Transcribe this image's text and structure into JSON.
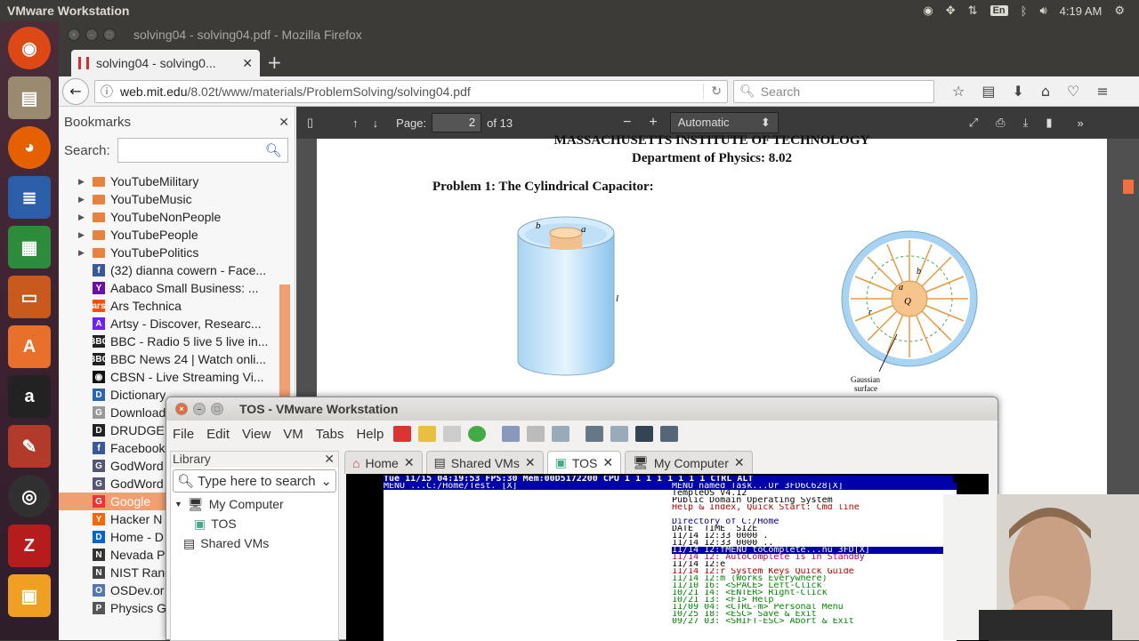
{
  "topbar": {
    "app": "VMware Workstation",
    "lang": "En",
    "time": "4:19 AM"
  },
  "launcher": {
    "items": [
      "ubuntu-icon",
      "files-icon",
      "firefox-icon",
      "writer-icon",
      "calc-icon",
      "impress-icon",
      "software-center-icon",
      "amazon-icon",
      "settings-icon",
      "obs-icon",
      "filezilla-icon",
      "vmware-icon"
    ]
  },
  "firefox": {
    "window_title": "solving04 - solving04.pdf - Mozilla Firefox",
    "tab_title": "solving04 - solving0...",
    "url_host": "web.mit.edu",
    "url_path": "/8.02t/www/materials/ProblemSolving/solving04.pdf",
    "search_placeholder": "Search"
  },
  "sidebar": {
    "title": "Bookmarks",
    "search_label": "Search:",
    "items": [
      {
        "label": "YouTubeMilitary",
        "type": "folder"
      },
      {
        "label": "YouTubeMusic",
        "type": "folder"
      },
      {
        "label": "YouTubeNonPeople",
        "type": "folder"
      },
      {
        "label": "YouTubePeople",
        "type": "folder"
      },
      {
        "label": "YouTubePolitics",
        "type": "folder"
      },
      {
        "label": "(32) dianna cowern - Face...",
        "fav": "f",
        "color": "#3b5998"
      },
      {
        "label": "Aabaco Small Business: ...",
        "fav": "Y",
        "color": "#6b0fa8"
      },
      {
        "label": "Ars Technica",
        "fav": "ars",
        "color": "#ff4e00"
      },
      {
        "label": "Artsy - Discover, Researc...",
        "fav": "A",
        "color": "#6e1fff"
      },
      {
        "label": "BBC - Radio 5 live 5 live in...",
        "fav": "BBC",
        "color": "#222"
      },
      {
        "label": "BBC News 24 | Watch onli...",
        "fav": "BBC",
        "color": "#222"
      },
      {
        "label": "CBSN - Live Streaming Vi...",
        "fav": "◉",
        "color": "#111"
      },
      {
        "label": "Dictionary",
        "fav": "D",
        "color": "#2a66b8"
      },
      {
        "label": "Download",
        "fav": "G",
        "color": "#999"
      },
      {
        "label": "DRUDGE",
        "fav": "D",
        "color": "#222"
      },
      {
        "label": "Facebook",
        "fav": "f",
        "color": "#3b5998"
      },
      {
        "label": "GodWord",
        "fav": "G",
        "color": "#557"
      },
      {
        "label": "GodWord",
        "fav": "G",
        "color": "#557"
      },
      {
        "label": "Google",
        "fav": "G",
        "color": "#e33",
        "selected": true
      },
      {
        "label": "Hacker N",
        "fav": "Y",
        "color": "#f60"
      },
      {
        "label": "Home - D",
        "fav": "D",
        "color": "#06c"
      },
      {
        "label": "Nevada P",
        "fav": "N",
        "color": "#333"
      },
      {
        "label": "NIST Rand",
        "fav": "N",
        "color": "#444"
      },
      {
        "label": "OSDev.or",
        "fav": "O",
        "color": "#5577aa"
      },
      {
        "label": "Physics G",
        "fav": "P",
        "color": "#555"
      }
    ]
  },
  "pdf": {
    "page_label": "Page:",
    "page": "2",
    "of": "of 13",
    "zoom": "Automatic Zoom",
    "heading1": "MASSACHUSETTS INSTITUTE OF TECHNOLOGY",
    "heading2": "Department of Physics:  8.02",
    "problem": "Problem 1: The Cylindrical Capacitor:",
    "gauss1": "Gaussian",
    "gauss2": "surface",
    "lbl_b": "b",
    "lbl_a": "a",
    "lbl_l": "l",
    "lbl_r": "r",
    "lbl_q": "Q"
  },
  "vmware": {
    "title": "TOS - VMware Workstation",
    "menu": [
      "File",
      "Edit",
      "View",
      "VM",
      "Tabs",
      "Help"
    ],
    "library": "Library",
    "lib_search": "Type here to search",
    "tree": {
      "root": "My Computer",
      "vm": "TOS",
      "shared": "Shared VMs"
    },
    "tabs": [
      "Home",
      "Shared VMs",
      "TOS",
      "My Computer"
    ]
  },
  "tos": {
    "status": "Tue 11/15 04:19:53 FPS:30 Mem:00D5172200 CPU 1 1 1 1 1 1 1 1    CTRL ALT",
    "left_menu": "MENU       ...C:/Home/Test.              [X]",
    "right_menu": "MENU          named Task...Ur  3FD6C628[X]",
    "lines": [
      "            TempleOS V4.12",
      "   Public Domain Operating System",
      "Help & Index, Quick Start: Cmd line",
      "",
      "Directory of C:/Home",
      "DATE_ TIME_ SIZE",
      "11/14 12:33 0000 .",
      "11/14 12:33 0000 ..",
      "11/14 12:fMENU     toComplete...nu 3FD[X]",
      "11/14 12:   AutoComplete is in StandBy",
      "11/14 12:e",
      "11/14 12:r  System Keys Quick Guide",
      "11/14 12:m      (Works Everywhere)",
      "11/10 16:    <SPACE>    Left-Click",
      "10/21 14:    <ENTER>    Right-Click",
      "10/21 13:     <F1>      Help",
      "11/09 04:   <CTRL-m>    Personal Menu",
      "10/25 18:     <ESC>     Save & Exit",
      "09/27 03: <SHIFT-ESC>   Abort & Exit"
    ]
  }
}
